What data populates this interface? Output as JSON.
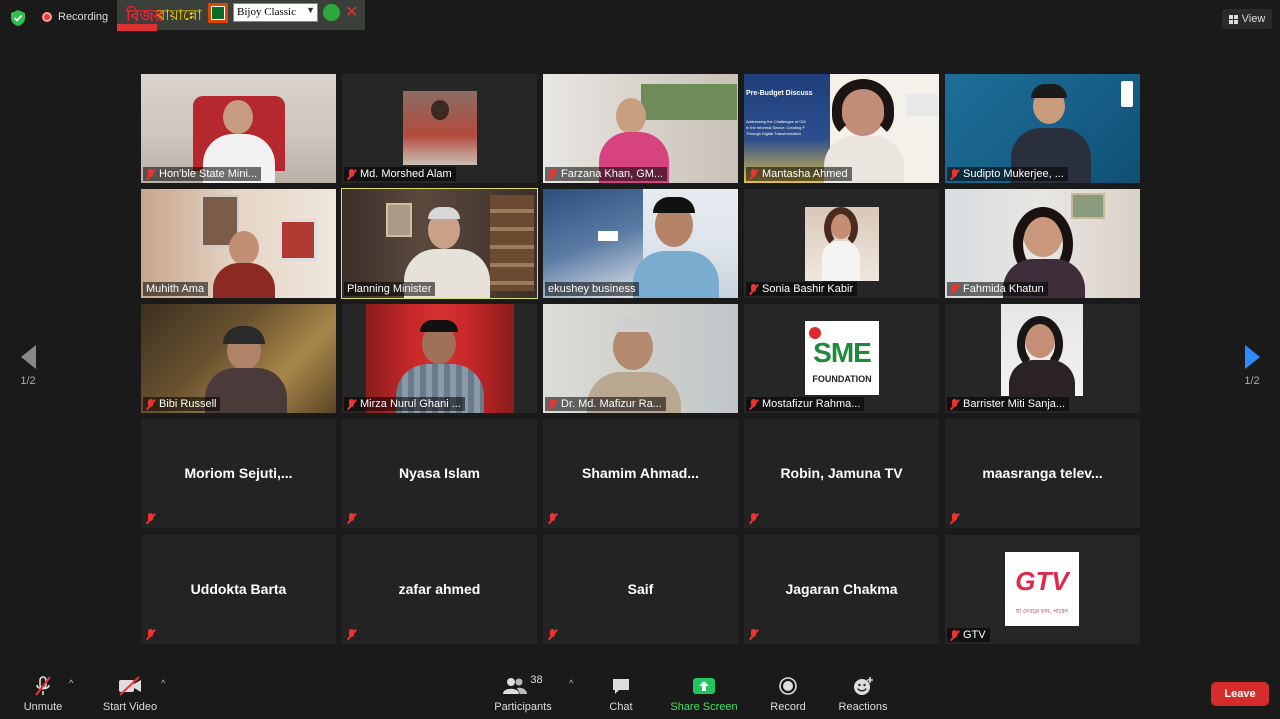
{
  "topbar": {
    "recording_label": "Recording",
    "bijoy_logo_red": "বিজয়",
    "bijoy_logo_yellow": "বায়ান্নো",
    "keyboard_select": "Bijoy Classic",
    "view_label": "View"
  },
  "pager": {
    "left_page": "1/2",
    "right_page": "1/2"
  },
  "tiles": [
    {
      "name": "Hon'ble State Mini...",
      "type": "video"
    },
    {
      "name": "Md. Morshed Alam",
      "type": "video"
    },
    {
      "name": "Farzana Khan, GM...",
      "type": "video"
    },
    {
      "name": "Mantasha Ahmed",
      "type": "video"
    },
    {
      "name": "Sudipto Mukerjee, ...",
      "type": "video"
    },
    {
      "name": "Muhith Ama",
      "type": "video"
    },
    {
      "name": "Planning Minister",
      "type": "video"
    },
    {
      "name": "ekushey business",
      "type": "video"
    },
    {
      "name": "Sonia Bashir Kabir",
      "type": "video"
    },
    {
      "name": "Fahmida Khatun",
      "type": "video"
    },
    {
      "name": "Bibi Russell",
      "type": "video"
    },
    {
      "name": "Mirza Nurul Ghani ...",
      "type": "video"
    },
    {
      "name": "Dr. Md. Mafizur Ra...",
      "type": "video"
    },
    {
      "name": "Mostafizur Rahma...",
      "type": "video"
    },
    {
      "name": "Barrister Miti Sanja...",
      "type": "video"
    },
    {
      "name": "Moriom  Sejuti,...",
      "type": "name"
    },
    {
      "name": "Nyasa Islam",
      "type": "name"
    },
    {
      "name": "Shamim  Ahmad...",
      "type": "name"
    },
    {
      "name": "Robin, Jamuna TV",
      "type": "name"
    },
    {
      "name": "maasranga  telev...",
      "type": "name"
    },
    {
      "name": "Uddokta Barta",
      "type": "name"
    },
    {
      "name": "zafar ahmed",
      "type": "name"
    },
    {
      "name": "Saif",
      "type": "name"
    },
    {
      "name": "Jagaran Chakma",
      "type": "name"
    },
    {
      "name": "GTV",
      "type": "video"
    }
  ],
  "slide": {
    "title": "Pre-Budget Discuss",
    "line1": "Addressing the Challenges of CM",
    "line2": "in the Informal Sector: Creating F",
    "line3": "Through Digital Transformation"
  },
  "sme_logo": {
    "line1": "SME",
    "line2": "FOUNDATION"
  },
  "gtv_logo": {
    "text": "GTV",
    "tagline": "যা দেখতে চান, পাবেন"
  },
  "toolbar": {
    "unmute": "Unmute",
    "start_video": "Start Video",
    "participants": "Participants",
    "participants_count": "38",
    "chat": "Chat",
    "share_screen": "Share Screen",
    "record": "Record",
    "reactions": "Reactions",
    "leave": "Leave"
  },
  "colors": {
    "accent_blue": "#2d8cff",
    "share_green": "#22c55e",
    "leave_red": "#d52b2b",
    "active_speaker": "#d7e06a"
  }
}
